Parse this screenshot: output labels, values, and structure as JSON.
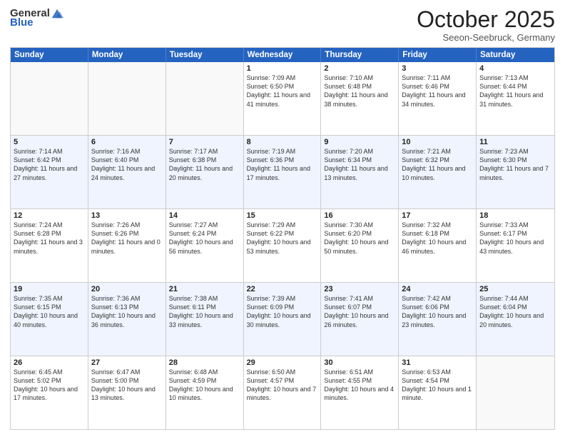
{
  "header": {
    "logo_general": "General",
    "logo_blue": "Blue",
    "month_title": "October 2025",
    "location": "Seeon-Seebruck, Germany"
  },
  "days_of_week": [
    "Sunday",
    "Monday",
    "Tuesday",
    "Wednesday",
    "Thursday",
    "Friday",
    "Saturday"
  ],
  "weeks": [
    [
      {
        "day": "",
        "sunrise": "",
        "sunset": "",
        "daylight": "",
        "empty": true
      },
      {
        "day": "",
        "sunrise": "",
        "sunset": "",
        "daylight": "",
        "empty": true
      },
      {
        "day": "",
        "sunrise": "",
        "sunset": "",
        "daylight": "",
        "empty": true
      },
      {
        "day": "1",
        "sunrise": "Sunrise: 7:09 AM",
        "sunset": "Sunset: 6:50 PM",
        "daylight": "Daylight: 11 hours and 41 minutes.",
        "empty": false
      },
      {
        "day": "2",
        "sunrise": "Sunrise: 7:10 AM",
        "sunset": "Sunset: 6:48 PM",
        "daylight": "Daylight: 11 hours and 38 minutes.",
        "empty": false
      },
      {
        "day": "3",
        "sunrise": "Sunrise: 7:11 AM",
        "sunset": "Sunset: 6:46 PM",
        "daylight": "Daylight: 11 hours and 34 minutes.",
        "empty": false
      },
      {
        "day": "4",
        "sunrise": "Sunrise: 7:13 AM",
        "sunset": "Sunset: 6:44 PM",
        "daylight": "Daylight: 11 hours and 31 minutes.",
        "empty": false
      }
    ],
    [
      {
        "day": "5",
        "sunrise": "Sunrise: 7:14 AM",
        "sunset": "Sunset: 6:42 PM",
        "daylight": "Daylight: 11 hours and 27 minutes.",
        "empty": false
      },
      {
        "day": "6",
        "sunrise": "Sunrise: 7:16 AM",
        "sunset": "Sunset: 6:40 PM",
        "daylight": "Daylight: 11 hours and 24 minutes.",
        "empty": false
      },
      {
        "day": "7",
        "sunrise": "Sunrise: 7:17 AM",
        "sunset": "Sunset: 6:38 PM",
        "daylight": "Daylight: 11 hours and 20 minutes.",
        "empty": false
      },
      {
        "day": "8",
        "sunrise": "Sunrise: 7:19 AM",
        "sunset": "Sunset: 6:36 PM",
        "daylight": "Daylight: 11 hours and 17 minutes.",
        "empty": false
      },
      {
        "day": "9",
        "sunrise": "Sunrise: 7:20 AM",
        "sunset": "Sunset: 6:34 PM",
        "daylight": "Daylight: 11 hours and 13 minutes.",
        "empty": false
      },
      {
        "day": "10",
        "sunrise": "Sunrise: 7:21 AM",
        "sunset": "Sunset: 6:32 PM",
        "daylight": "Daylight: 11 hours and 10 minutes.",
        "empty": false
      },
      {
        "day": "11",
        "sunrise": "Sunrise: 7:23 AM",
        "sunset": "Sunset: 6:30 PM",
        "daylight": "Daylight: 11 hours and 7 minutes.",
        "empty": false
      }
    ],
    [
      {
        "day": "12",
        "sunrise": "Sunrise: 7:24 AM",
        "sunset": "Sunset: 6:28 PM",
        "daylight": "Daylight: 11 hours and 3 minutes.",
        "empty": false
      },
      {
        "day": "13",
        "sunrise": "Sunrise: 7:26 AM",
        "sunset": "Sunset: 6:26 PM",
        "daylight": "Daylight: 11 hours and 0 minutes.",
        "empty": false
      },
      {
        "day": "14",
        "sunrise": "Sunrise: 7:27 AM",
        "sunset": "Sunset: 6:24 PM",
        "daylight": "Daylight: 10 hours and 56 minutes.",
        "empty": false
      },
      {
        "day": "15",
        "sunrise": "Sunrise: 7:29 AM",
        "sunset": "Sunset: 6:22 PM",
        "daylight": "Daylight: 10 hours and 53 minutes.",
        "empty": false
      },
      {
        "day": "16",
        "sunrise": "Sunrise: 7:30 AM",
        "sunset": "Sunset: 6:20 PM",
        "daylight": "Daylight: 10 hours and 50 minutes.",
        "empty": false
      },
      {
        "day": "17",
        "sunrise": "Sunrise: 7:32 AM",
        "sunset": "Sunset: 6:18 PM",
        "daylight": "Daylight: 10 hours and 46 minutes.",
        "empty": false
      },
      {
        "day": "18",
        "sunrise": "Sunrise: 7:33 AM",
        "sunset": "Sunset: 6:17 PM",
        "daylight": "Daylight: 10 hours and 43 minutes.",
        "empty": false
      }
    ],
    [
      {
        "day": "19",
        "sunrise": "Sunrise: 7:35 AM",
        "sunset": "Sunset: 6:15 PM",
        "daylight": "Daylight: 10 hours and 40 minutes.",
        "empty": false
      },
      {
        "day": "20",
        "sunrise": "Sunrise: 7:36 AM",
        "sunset": "Sunset: 6:13 PM",
        "daylight": "Daylight: 10 hours and 36 minutes.",
        "empty": false
      },
      {
        "day": "21",
        "sunrise": "Sunrise: 7:38 AM",
        "sunset": "Sunset: 6:11 PM",
        "daylight": "Daylight: 10 hours and 33 minutes.",
        "empty": false
      },
      {
        "day": "22",
        "sunrise": "Sunrise: 7:39 AM",
        "sunset": "Sunset: 6:09 PM",
        "daylight": "Daylight: 10 hours and 30 minutes.",
        "empty": false
      },
      {
        "day": "23",
        "sunrise": "Sunrise: 7:41 AM",
        "sunset": "Sunset: 6:07 PM",
        "daylight": "Daylight: 10 hours and 26 minutes.",
        "empty": false
      },
      {
        "day": "24",
        "sunrise": "Sunrise: 7:42 AM",
        "sunset": "Sunset: 6:06 PM",
        "daylight": "Daylight: 10 hours and 23 minutes.",
        "empty": false
      },
      {
        "day": "25",
        "sunrise": "Sunrise: 7:44 AM",
        "sunset": "Sunset: 6:04 PM",
        "daylight": "Daylight: 10 hours and 20 minutes.",
        "empty": false
      }
    ],
    [
      {
        "day": "26",
        "sunrise": "Sunrise: 6:45 AM",
        "sunset": "Sunset: 5:02 PM",
        "daylight": "Daylight: 10 hours and 17 minutes.",
        "empty": false
      },
      {
        "day": "27",
        "sunrise": "Sunrise: 6:47 AM",
        "sunset": "Sunset: 5:00 PM",
        "daylight": "Daylight: 10 hours and 13 minutes.",
        "empty": false
      },
      {
        "day": "28",
        "sunrise": "Sunrise: 6:48 AM",
        "sunset": "Sunset: 4:59 PM",
        "daylight": "Daylight: 10 hours and 10 minutes.",
        "empty": false
      },
      {
        "day": "29",
        "sunrise": "Sunrise: 6:50 AM",
        "sunset": "Sunset: 4:57 PM",
        "daylight": "Daylight: 10 hours and 7 minutes.",
        "empty": false
      },
      {
        "day": "30",
        "sunrise": "Sunrise: 6:51 AM",
        "sunset": "Sunset: 4:55 PM",
        "daylight": "Daylight: 10 hours and 4 minutes.",
        "empty": false
      },
      {
        "day": "31",
        "sunrise": "Sunrise: 6:53 AM",
        "sunset": "Sunset: 4:54 PM",
        "daylight": "Daylight: 10 hours and 1 minute.",
        "empty": false
      },
      {
        "day": "",
        "sunrise": "",
        "sunset": "",
        "daylight": "",
        "empty": true
      }
    ]
  ]
}
